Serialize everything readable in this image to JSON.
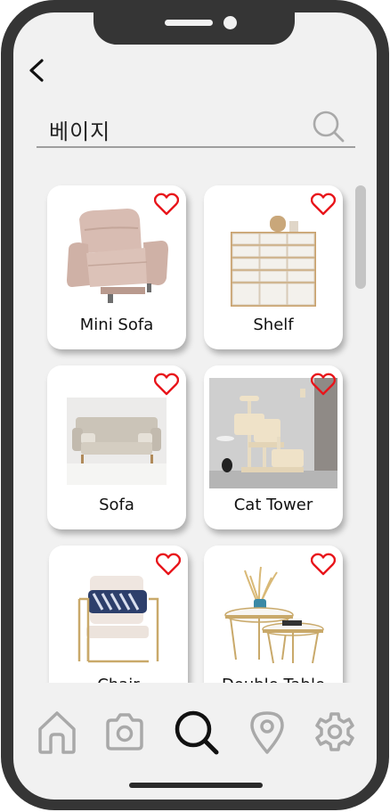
{
  "search": {
    "query": "베이지"
  },
  "products": [
    {
      "label": "Mini Sofa",
      "favorite": false
    },
    {
      "label": "Shelf",
      "favorite": false
    },
    {
      "label": "Sofa",
      "favorite": false
    },
    {
      "label": "Cat Tower",
      "favorite": false
    },
    {
      "label": "Chair",
      "favorite": false
    },
    {
      "label": "Double Table",
      "favorite": false
    }
  ],
  "bottom_nav": {
    "items": [
      {
        "icon": "home-icon"
      },
      {
        "icon": "camera-icon"
      },
      {
        "icon": "search-icon",
        "active": true
      },
      {
        "icon": "location-pin-icon"
      },
      {
        "icon": "gear-icon"
      }
    ]
  },
  "colors": {
    "frame": "#353535",
    "screen": "#f1f1f1",
    "heart": "#e8151b",
    "nav_inactive": "#a9a9a9",
    "nav_active": "#111111"
  }
}
